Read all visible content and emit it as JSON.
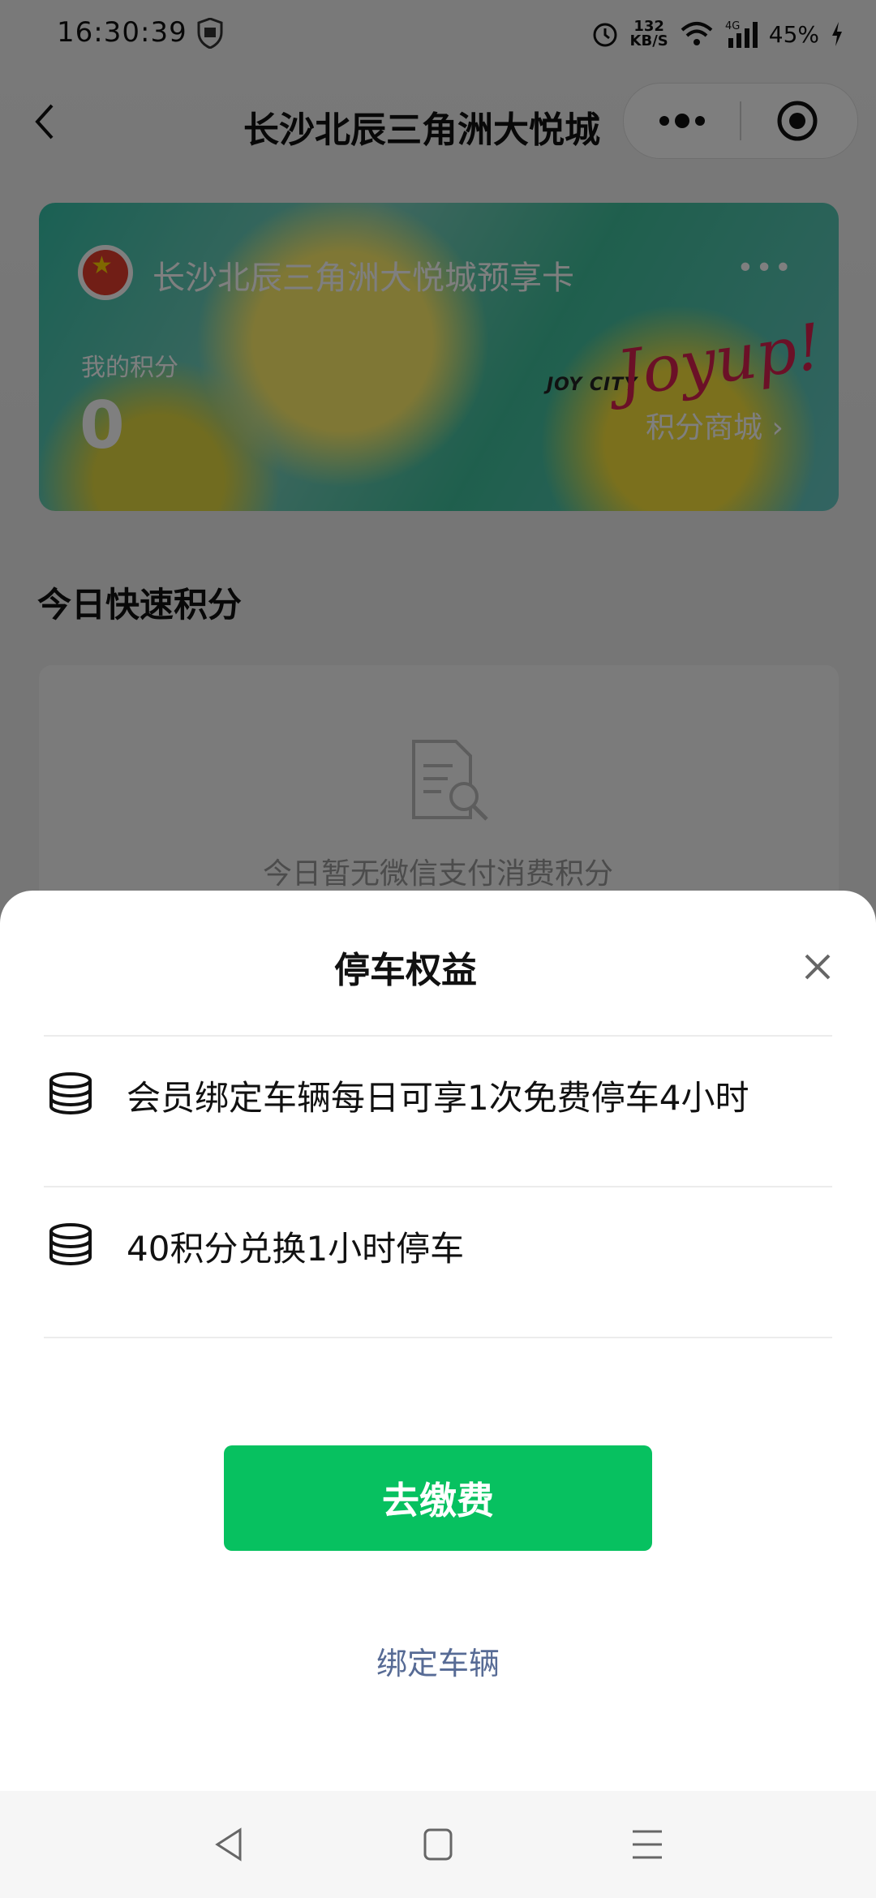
{
  "status_bar": {
    "time": "16:30:39",
    "net_speed": "132",
    "net_unit": "KB/S",
    "network": "4G",
    "battery": "45%"
  },
  "nav": {
    "title": "长沙北辰三角洲大悦城"
  },
  "card": {
    "name": "长沙北辰三角洲大悦城预享卡",
    "more": "•••",
    "points_label": "我的积分",
    "points_value": "0",
    "brand_text": "JOY CITY",
    "brand_script": "Joyup!",
    "mall_link": "积分商城 ›"
  },
  "quick_points": {
    "title": "今日快速积分",
    "empty_text": "今日暂无微信支付消费积分"
  },
  "sheet": {
    "title": "停车权益",
    "benefits": [
      {
        "icon": "coins-icon",
        "text": "会员绑定车辆每日可享1次免费停车4小时"
      },
      {
        "icon": "coins-icon",
        "text": "40积分兑换1小时停车"
      }
    ],
    "pay_button": "去缴费",
    "bind_link": "绑定车辆"
  },
  "colors": {
    "primary_green": "#07c160",
    "link_blue": "#576b95",
    "overlay": "rgba(0,0,0,0.5)"
  }
}
